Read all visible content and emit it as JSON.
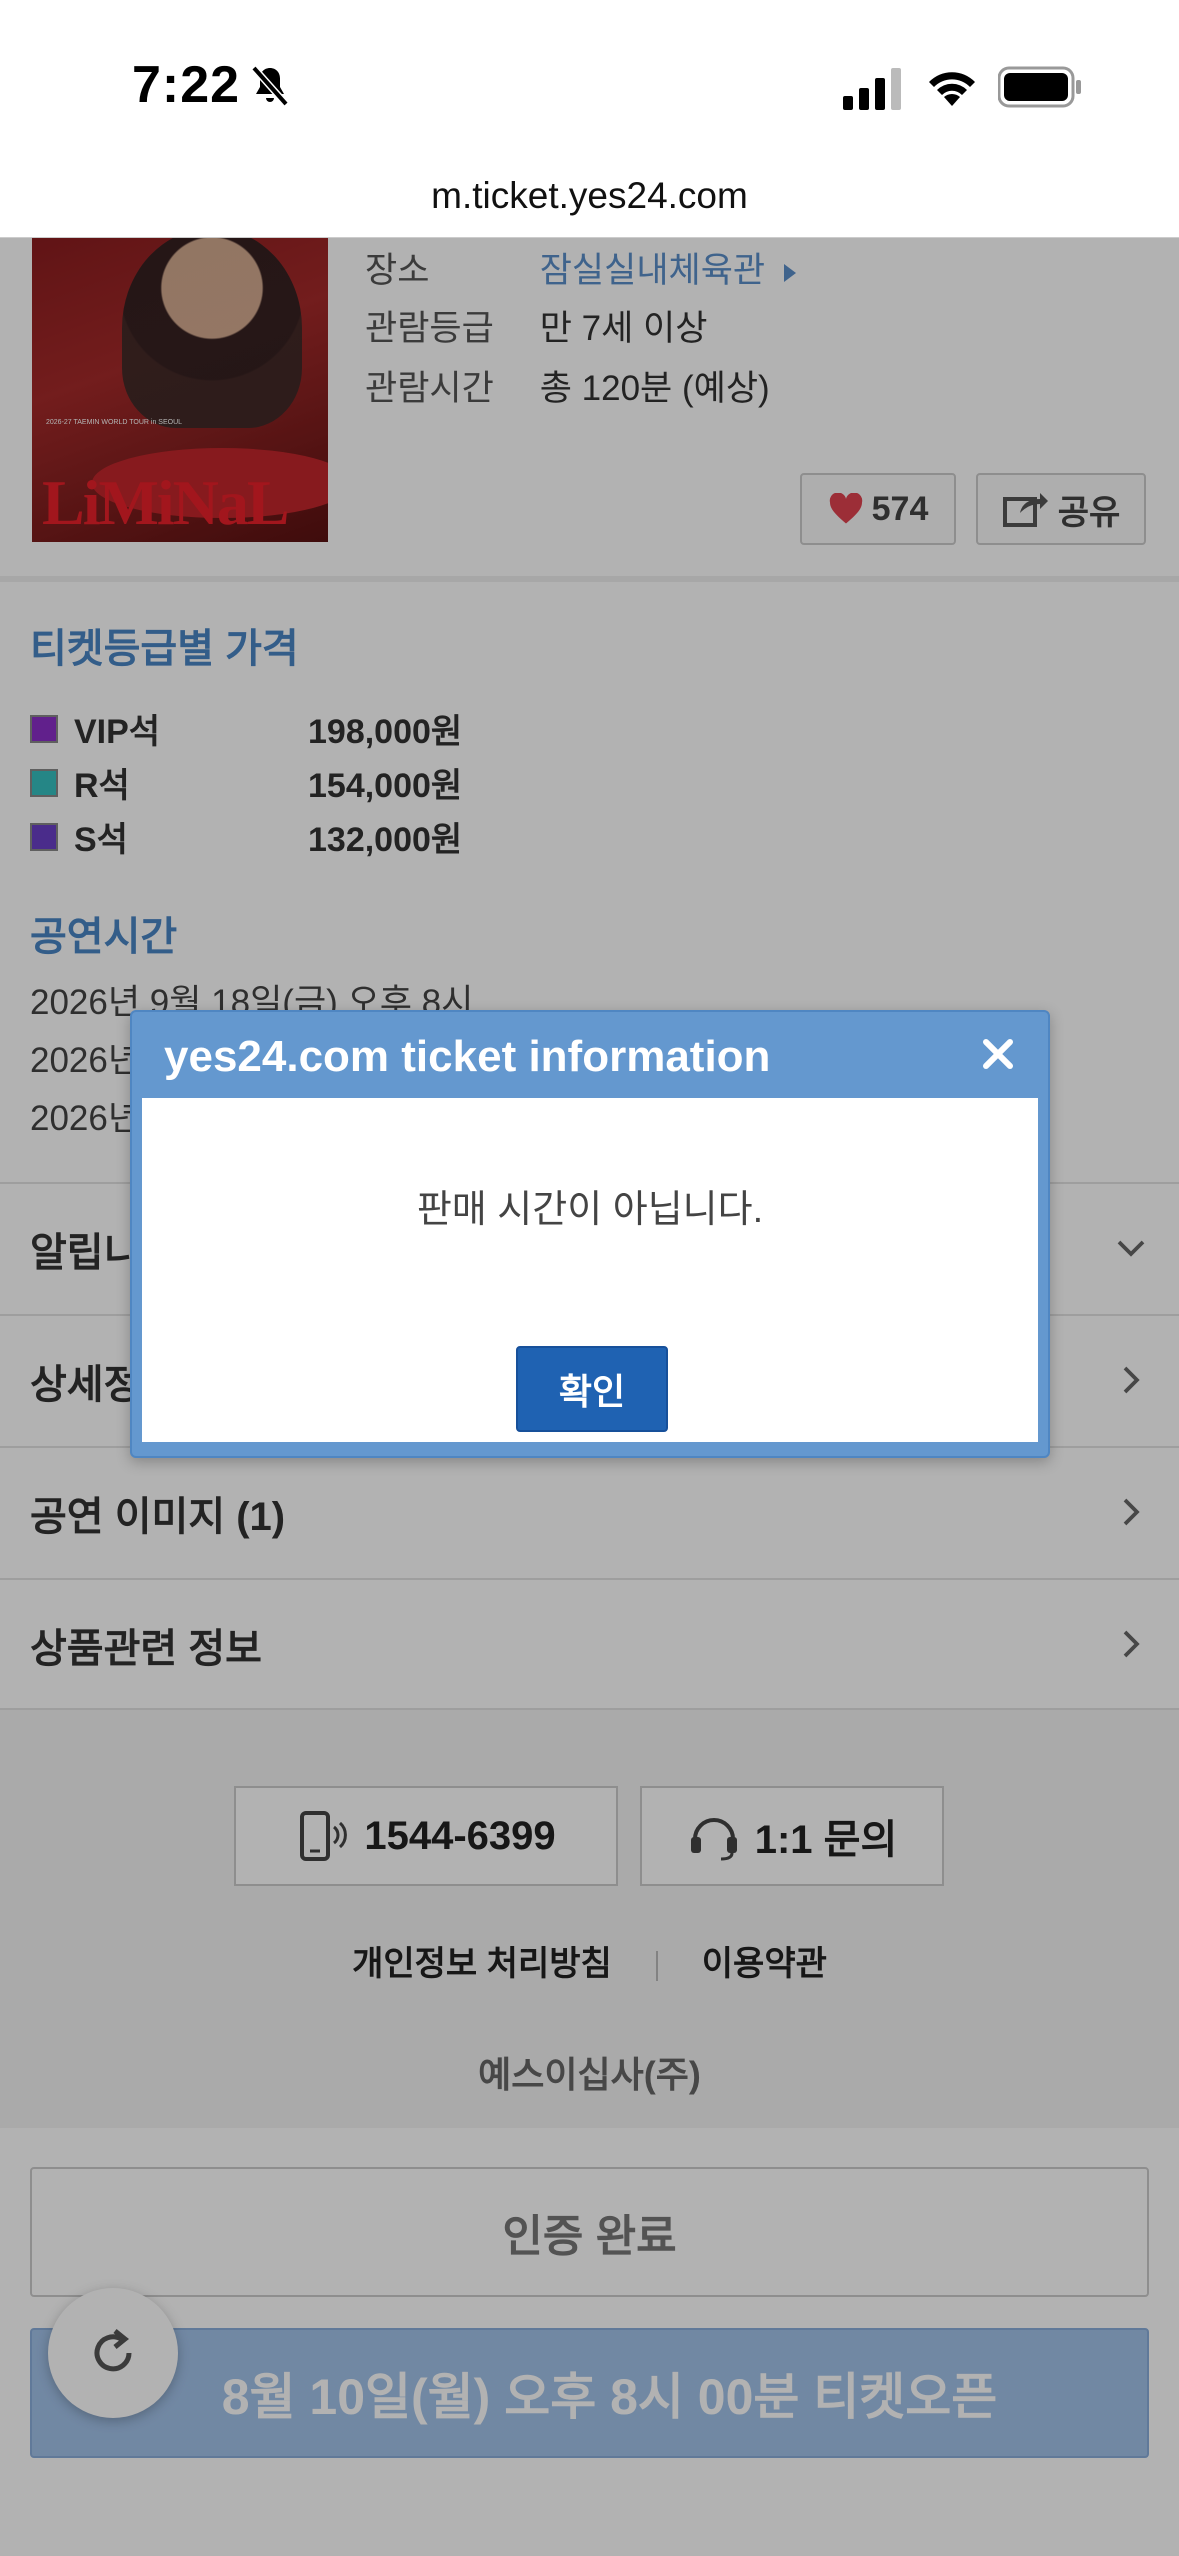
{
  "status_bar": {
    "time": "7:22"
  },
  "browser": {
    "url": "m.ticket.yes24.com"
  },
  "event": {
    "poster": {
      "tour_line": "2026-27 TAEMIN WORLD TOUR in SEOUL",
      "logo_text": "LiMiNaL"
    },
    "venue_label": "장소",
    "venue_value": "잠실실내체육관",
    "rating_label": "관람등급",
    "rating_value": "만 7세 이상",
    "duration_label": "관람시간",
    "duration_value": "총 120분 (예상)",
    "likes": "574",
    "share_label": "공유"
  },
  "prices": {
    "title": "티켓등급별 가격",
    "items": [
      {
        "grade": "VIP석",
        "price": "198,000원",
        "color": "#8b2fc9"
      },
      {
        "grade": "R석",
        "price": "154,000원",
        "color": "#35c0c0"
      },
      {
        "grade": "S석",
        "price": "132,000원",
        "color": "#6a40c8"
      }
    ]
  },
  "performance": {
    "title": "공연시간",
    "lines": [
      "2026년 9월 18일(금) 오후 8시",
      "2026년",
      "2026년"
    ]
  },
  "menu": {
    "notice": "알립니",
    "detail": "상세정",
    "images": "공연 이미지 (1)",
    "product_info": "상품관련 정보"
  },
  "footer": {
    "phone": "1544-6399",
    "inquiry": "1:1 문의",
    "privacy": "개인정보 처리방침",
    "terms": "이용약관",
    "company": "예스이십사(주)"
  },
  "actions": {
    "cert": "인증 완료",
    "open": "8월 10일(월) 오후 8시 00분 티켓오픈"
  },
  "dialog": {
    "title": "yes24.com ticket information",
    "message": "판매 시간이 아닙니다.",
    "ok": "확인"
  },
  "colors": {
    "accent": "#4a86c5",
    "dialog_header": "#6498cf",
    "ok_button": "#1f62b2",
    "heart": "#e0424f"
  }
}
